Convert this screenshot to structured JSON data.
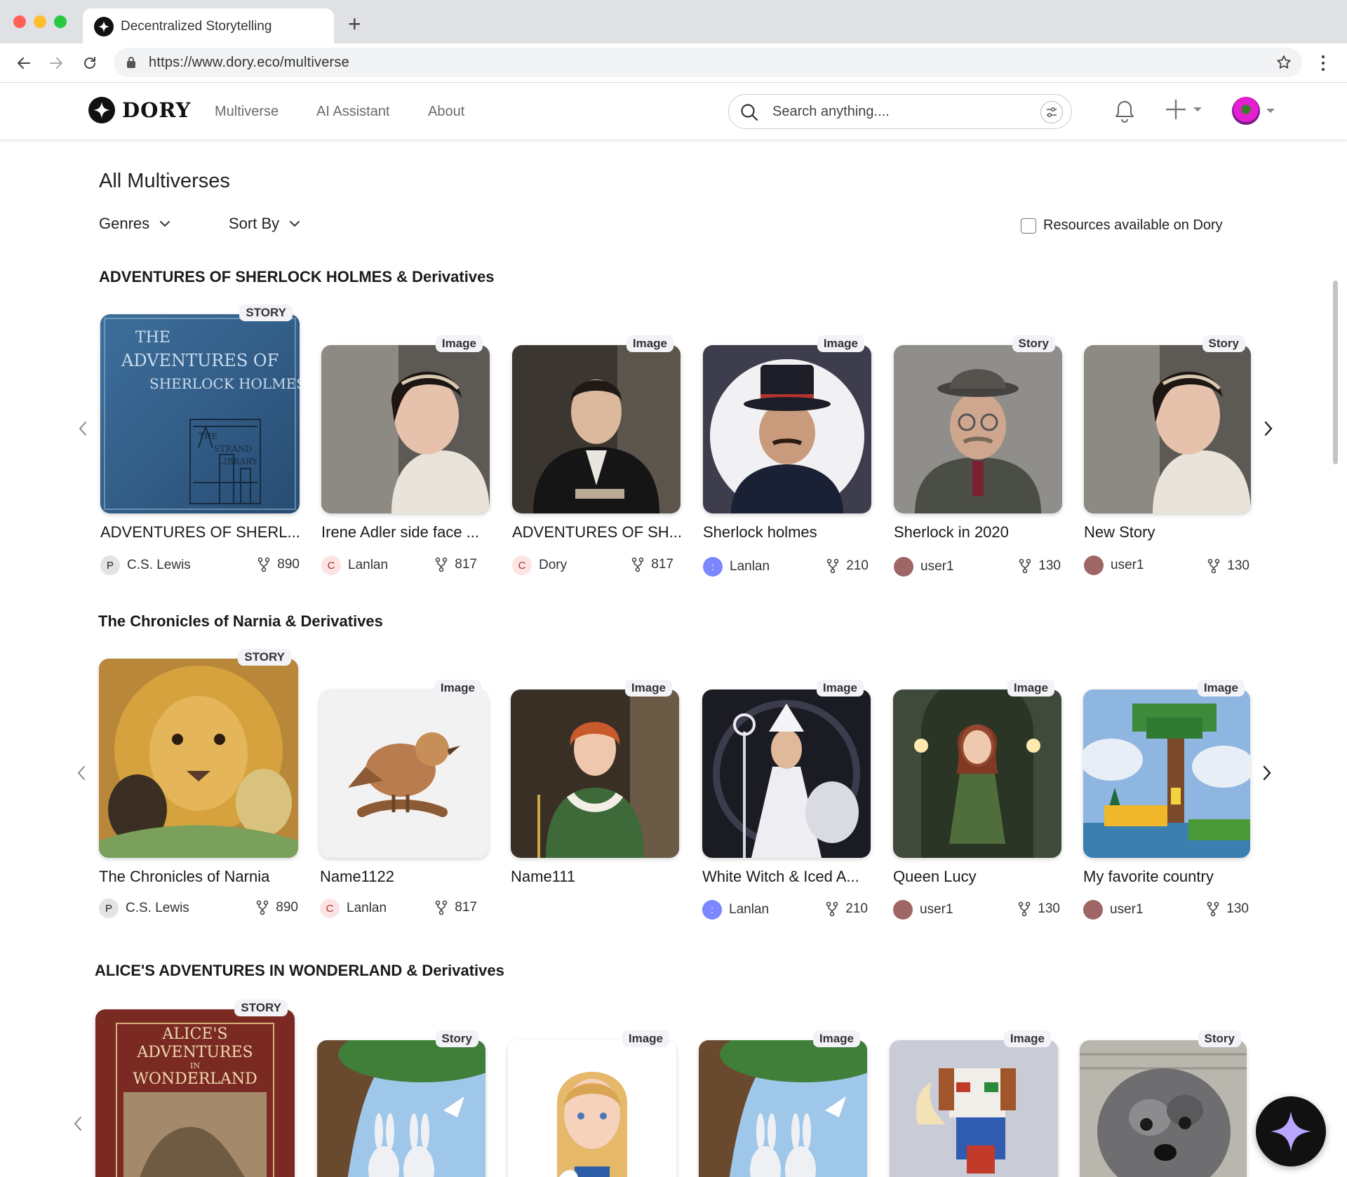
{
  "browser": {
    "tab_title": "Decentralized Storytelling",
    "url": "https://www.dory.eco/multiverse"
  },
  "header": {
    "logo_text": "DORY",
    "nav": [
      "Multiverse",
      "AI Assistant",
      "About"
    ],
    "search_placeholder": "Search anything...."
  },
  "page": {
    "title": "All Multiverses",
    "genres_label": "Genres",
    "sort_label": "Sort By",
    "resources_label": "Resources available on Dory"
  },
  "sections": [
    {
      "title": "ADVENTURES OF SHERLOCK HOLMES & Derivatives",
      "cards": [
        {
          "badge": "STORY",
          "title": "ADVENTURES OF SHERL...",
          "author": "C.S. Lewis",
          "initial": "P",
          "forks": "890"
        },
        {
          "badge": "Image",
          "title": "Irene Adler side face ...",
          "author": "Lanlan",
          "initial": "C",
          "forks": "817"
        },
        {
          "badge": "Image",
          "title": "ADVENTURES OF SH...",
          "author": "Dory",
          "initial": "C",
          "forks": "817"
        },
        {
          "badge": "Image",
          "title": "Sherlock holmes",
          "author": "Lanlan",
          "initial": ":",
          "forks": "210"
        },
        {
          "badge": "Story",
          "title": "Sherlock in 2020",
          "author": "user1",
          "initial": "",
          "forks": "130"
        },
        {
          "badge": "Story",
          "title": "New Story",
          "author": "user1",
          "initial": "",
          "forks": "130"
        }
      ]
    },
    {
      "title": "The Chronicles of Narnia & Derivatives",
      "cards": [
        {
          "badge": "STORY",
          "title": "The Chronicles of Narnia",
          "author": "C.S. Lewis",
          "initial": "P",
          "forks": "890"
        },
        {
          "badge": "Image",
          "title": "Name1122",
          "author": "Lanlan",
          "initial": "C",
          "forks": "817"
        },
        {
          "badge": "Image",
          "title": "Name111",
          "author": "",
          "initial": "",
          "forks": ""
        },
        {
          "badge": "Image",
          "title": "White Witch & Iced A...",
          "author": "Lanlan",
          "initial": ":",
          "forks": "210"
        },
        {
          "badge": "Image",
          "title": "Queen Lucy",
          "author": "user1",
          "initial": "",
          "forks": "130"
        },
        {
          "badge": "Image",
          "title": "My favorite country",
          "author": "user1",
          "initial": "",
          "forks": "130"
        }
      ]
    },
    {
      "title": "ALICE'S ADVENTURES IN WONDERLAND & Derivatives",
      "cards": [
        {
          "badge": "STORY"
        },
        {
          "badge": "Story"
        },
        {
          "badge": "Image"
        },
        {
          "badge": "Image"
        },
        {
          "badge": "Image"
        },
        {
          "badge": "Story"
        }
      ]
    }
  ],
  "book_covers": {
    "sherlock_lines": [
      "THE",
      "ADVENTURES OF",
      "SHERLOCK HOLMES"
    ],
    "sherlock_sub": [
      "THE",
      "STRAND",
      "LIBRARY"
    ],
    "alice_lines": [
      "ALICE'S",
      "ADVENTURES",
      "IN",
      "WONDERLAND"
    ]
  },
  "colors": {
    "accent_fab": "#111111",
    "fab_star": "#b9a6ff",
    "badge_bg": "#f2f2f7"
  }
}
